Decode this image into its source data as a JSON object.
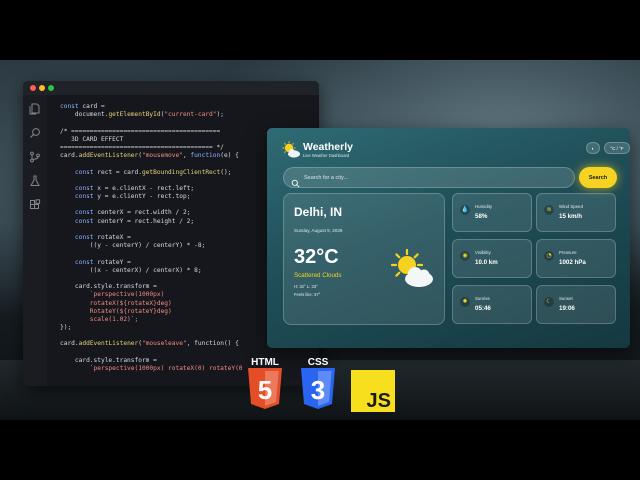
{
  "editor": {
    "window_controls": [
      "close",
      "minimize",
      "maximize"
    ],
    "activity_icons": [
      "files-icon",
      "search-icon",
      "source-control-icon",
      "flask-icon",
      "extensions-icon"
    ],
    "code_lines": [
      [
        {
          "t": "const",
          "c": "kw"
        },
        {
          "t": " card =",
          "c": ""
        }
      ],
      [
        {
          "t": "    document.",
          "c": ""
        },
        {
          "t": "getElementById",
          "c": "fn"
        },
        {
          "t": "(",
          "c": ""
        },
        {
          "t": "\"current-card\"",
          "c": "str"
        },
        {
          "t": ");",
          "c": ""
        }
      ],
      [],
      [
        {
          "t": "/* ========================================",
          "c": "cm"
        }
      ],
      [
        {
          "t": "   3D CARD EFFECT",
          "c": "cm"
        }
      ],
      [
        {
          "t": "========================================= */",
          "c": "cm"
        }
      ],
      [
        {
          "t": "card.",
          "c": ""
        },
        {
          "t": "addEventListener",
          "c": "fn"
        },
        {
          "t": "(",
          "c": ""
        },
        {
          "t": "\"mousemove\"",
          "c": "str"
        },
        {
          "t": ", ",
          "c": ""
        },
        {
          "t": "function",
          "c": "kw"
        },
        {
          "t": "(e) {",
          "c": ""
        }
      ],
      [],
      [
        {
          "t": "    ",
          "c": ""
        },
        {
          "t": "const",
          "c": "kw"
        },
        {
          "t": " rect = card.",
          "c": ""
        },
        {
          "t": "getBoundingClientRect",
          "c": "fn"
        },
        {
          "t": "();",
          "c": ""
        }
      ],
      [],
      [
        {
          "t": "    ",
          "c": ""
        },
        {
          "t": "const",
          "c": "kw"
        },
        {
          "t": " x = e.clientX - rect.left;",
          "c": ""
        }
      ],
      [
        {
          "t": "    ",
          "c": ""
        },
        {
          "t": "const",
          "c": "kw"
        },
        {
          "t": " y = e.clientY - rect.top;",
          "c": ""
        }
      ],
      [],
      [
        {
          "t": "    ",
          "c": ""
        },
        {
          "t": "const",
          "c": "kw"
        },
        {
          "t": " centerX = rect.width / 2;",
          "c": ""
        }
      ],
      [
        {
          "t": "    ",
          "c": ""
        },
        {
          "t": "const",
          "c": "kw"
        },
        {
          "t": " centerY = rect.height / 2;",
          "c": ""
        }
      ],
      [],
      [
        {
          "t": "    ",
          "c": ""
        },
        {
          "t": "const",
          "c": "kw"
        },
        {
          "t": " rotateX =",
          "c": ""
        }
      ],
      [
        {
          "t": "        ((y - centerY) / centerY) * -8;",
          "c": ""
        }
      ],
      [],
      [
        {
          "t": "    ",
          "c": ""
        },
        {
          "t": "const",
          "c": "kw"
        },
        {
          "t": " rotateY =",
          "c": ""
        }
      ],
      [
        {
          "t": "        ((x - centerX) / centerX) * 8;",
          "c": ""
        }
      ],
      [],
      [
        {
          "t": "    card.style.transform =",
          "c": ""
        }
      ],
      [
        {
          "t": "        `perspective(1000px)",
          "c": "str"
        }
      ],
      [
        {
          "t": "        rotateX(${rotateX}deg)",
          "c": "str"
        }
      ],
      [
        {
          "t": "        RotateY(${rotateY}deg)",
          "c": "str"
        }
      ],
      [
        {
          "t": "        scale(1.02)`;",
          "c": "str"
        }
      ],
      [
        {
          "t": "});",
          "c": ""
        }
      ],
      [],
      [
        {
          "t": "card.",
          "c": ""
        },
        {
          "t": "addEventListener",
          "c": "fn"
        },
        {
          "t": "(",
          "c": ""
        },
        {
          "t": "\"mouseleave\"",
          "c": "str"
        },
        {
          "t": ", function() {",
          "c": ""
        }
      ],
      [],
      [
        {
          "t": "    card.style.transform =",
          "c": ""
        }
      ],
      [
        {
          "t": "        `perspective(1000px) rotateX(0) rotateY(0",
          "c": "str"
        }
      ]
    ]
  },
  "weather_app": {
    "title": "Weatherly",
    "subtitle": "Live Weather Dashboard",
    "theme_toggle": "◐",
    "unit_toggle": "°C / °F",
    "search": {
      "placeholder": "Search for a city...",
      "button_label": "Search"
    },
    "current": {
      "city": "Delhi, IN",
      "date": "Sunday, August 9, 2026",
      "temperature": "32°C",
      "condition": "Scattered Clouds",
      "high_low": "H: 32° L: 33°",
      "feels_like": "Feels like: 37°",
      "icon": "sun-cloud-icon"
    },
    "stats": [
      {
        "label": "Humidity",
        "value": "58%",
        "icon": "droplet-icon",
        "glyph": "💧"
      },
      {
        "label": "Wind Speed",
        "value": "15 km/h",
        "icon": "wind-icon",
        "glyph": "≋"
      },
      {
        "label": "Visibility",
        "value": "10.0 km",
        "icon": "eye-icon",
        "glyph": "◉"
      },
      {
        "label": "Pressure",
        "value": "1002 hPa",
        "icon": "gauge-icon",
        "glyph": "◔"
      },
      {
        "label": "Sunrise",
        "value": "05:46",
        "icon": "sunrise-icon",
        "glyph": "✹"
      },
      {
        "label": "Sunset",
        "value": "19:06",
        "icon": "moon-icon",
        "glyph": "☾"
      }
    ],
    "accent_color": "#f5d320"
  },
  "logos": {
    "html_label": "HTML",
    "html_number": "5",
    "css_label": "CSS",
    "css_number": "3",
    "js_label": "JS",
    "html_color": "#e44d26",
    "css_color": "#2965f1",
    "js_color": "#f7df1e"
  }
}
